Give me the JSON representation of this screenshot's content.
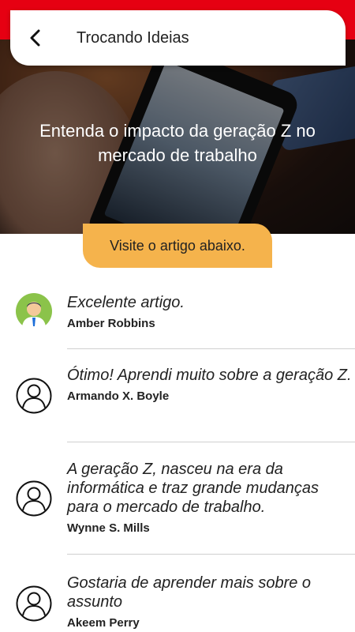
{
  "header": {
    "title": "Trocando Ideias",
    "back_icon": "chevron-left-icon"
  },
  "hero": {
    "title": "Entenda o impacto da geração Z no mercado de trabalho"
  },
  "cta": {
    "label": "Visite o artigo abaixo."
  },
  "comments": [
    {
      "text": "Excelente artigo.",
      "author": "Amber Robbins",
      "avatar": "user-photo-avatar"
    },
    {
      "text": "Ótimo! Aprendi muito sobre a geração Z.",
      "author": "Armando X. Boyle",
      "avatar": "user-outline-icon"
    },
    {
      "text": "A geração Z, nasceu na era da informática e traz grande mudanças para o mercado de trabalho.",
      "author": "Wynne S. Mills",
      "avatar": "user-outline-icon"
    },
    {
      "text": "Gostaria de aprender mais sobre o assunto",
      "author": "Akeem Perry",
      "avatar": "user-outline-icon"
    }
  ],
  "colors": {
    "top_strip": "#e60012",
    "cta": "#f5b34c"
  }
}
